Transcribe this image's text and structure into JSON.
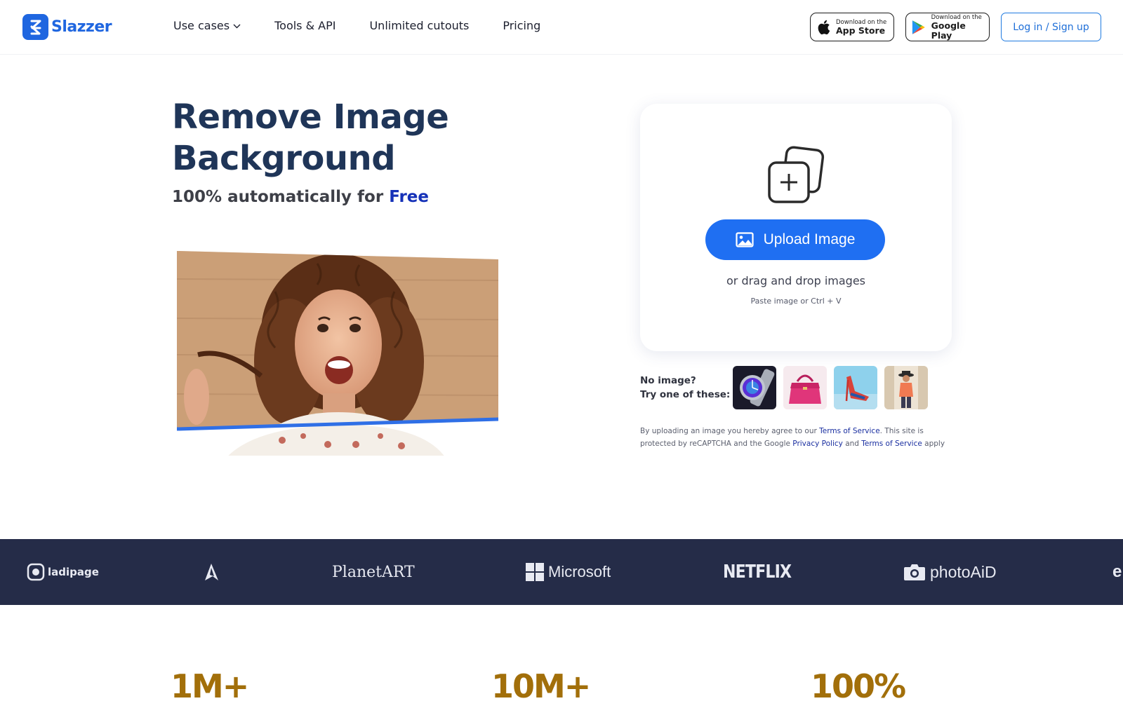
{
  "header": {
    "logo_text": "Slazzer",
    "nav": [
      {
        "label": "Use cases",
        "has_dropdown": true
      },
      {
        "label": "Tools & API"
      },
      {
        "label": "Unlimited cutouts"
      },
      {
        "label": "Pricing"
      }
    ],
    "app_store": {
      "small": "Download on the",
      "big": "App Store"
    },
    "google_play": {
      "small": "Download on the",
      "big": "Google Play"
    },
    "login_label": "Log in / Sign up"
  },
  "hero": {
    "title_line1": "Remove Image",
    "title_line2": "Background",
    "subtitle_prefix": "100% automatically for ",
    "subtitle_highlight": "Free"
  },
  "upload": {
    "button_label": "Upload Image",
    "drag_text": "or drag and drop images",
    "paste_text": "Paste image or Ctrl + V",
    "try_line1": "No image?",
    "try_line2": "Try one of these:",
    "samples": [
      "watch",
      "handbag",
      "high-heel shoe",
      "woman in hat"
    ]
  },
  "terms": {
    "part1": "By uploading an image you hereby agree to our ",
    "link1": "Terms of Service",
    "part2": ". This site is protected by reCAPTCHA and the Google ",
    "link2": "Privacy Policy",
    "part3": " and ",
    "link3": "Terms of Service",
    "part4": " apply"
  },
  "brands": [
    "ladipage",
    "PlanetART",
    "Microsoft",
    "NETFLIX",
    "photoAiD",
    "e"
  ],
  "stats": [
    "1M+",
    "10M+",
    "100%"
  ],
  "colors": {
    "brand_blue": "#1f66e0",
    "title_navy": "#1f3558",
    "free_blue": "#1531b8",
    "upload_button": "#1f6ff2",
    "band_bg": "#252c48",
    "stat_gold": "#a26f0a"
  }
}
